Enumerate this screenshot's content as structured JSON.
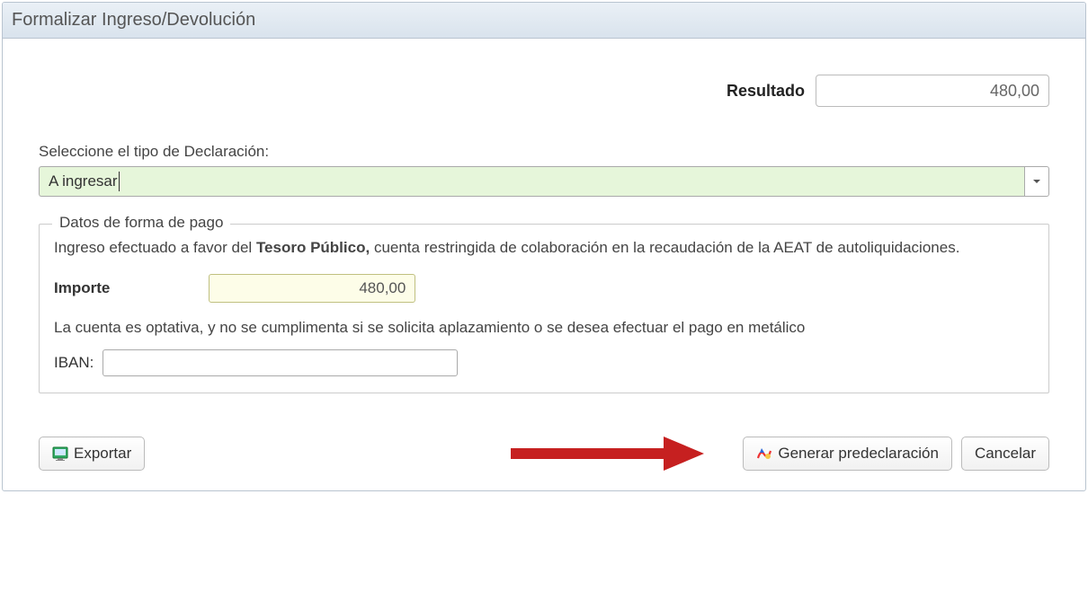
{
  "header": {
    "title": "Formalizar Ingreso/Devolución"
  },
  "resultado": {
    "label": "Resultado",
    "value": "480,00"
  },
  "seleccione": {
    "label": "Seleccione el tipo de Declaración:",
    "value": "A ingresar"
  },
  "fieldset": {
    "legend": "Datos de forma de pago",
    "info_pre": "Ingreso efectuado a favor del ",
    "info_bold": "Tesoro Público,",
    "info_post": "  cuenta restringida de colaboración en la recaudación de la AEAT de autoliquidaciones.",
    "importe_label": "Importe",
    "importe_value": "480,00",
    "hint": "La cuenta es optativa, y no se cumplimenta si se solicita aplazamiento o se desea efectuar el pago en metálico",
    "iban_label": "IBAN:",
    "iban_value": ""
  },
  "buttons": {
    "exportar": "Exportar",
    "generar": "Generar predeclaración",
    "cancelar": "Cancelar"
  }
}
